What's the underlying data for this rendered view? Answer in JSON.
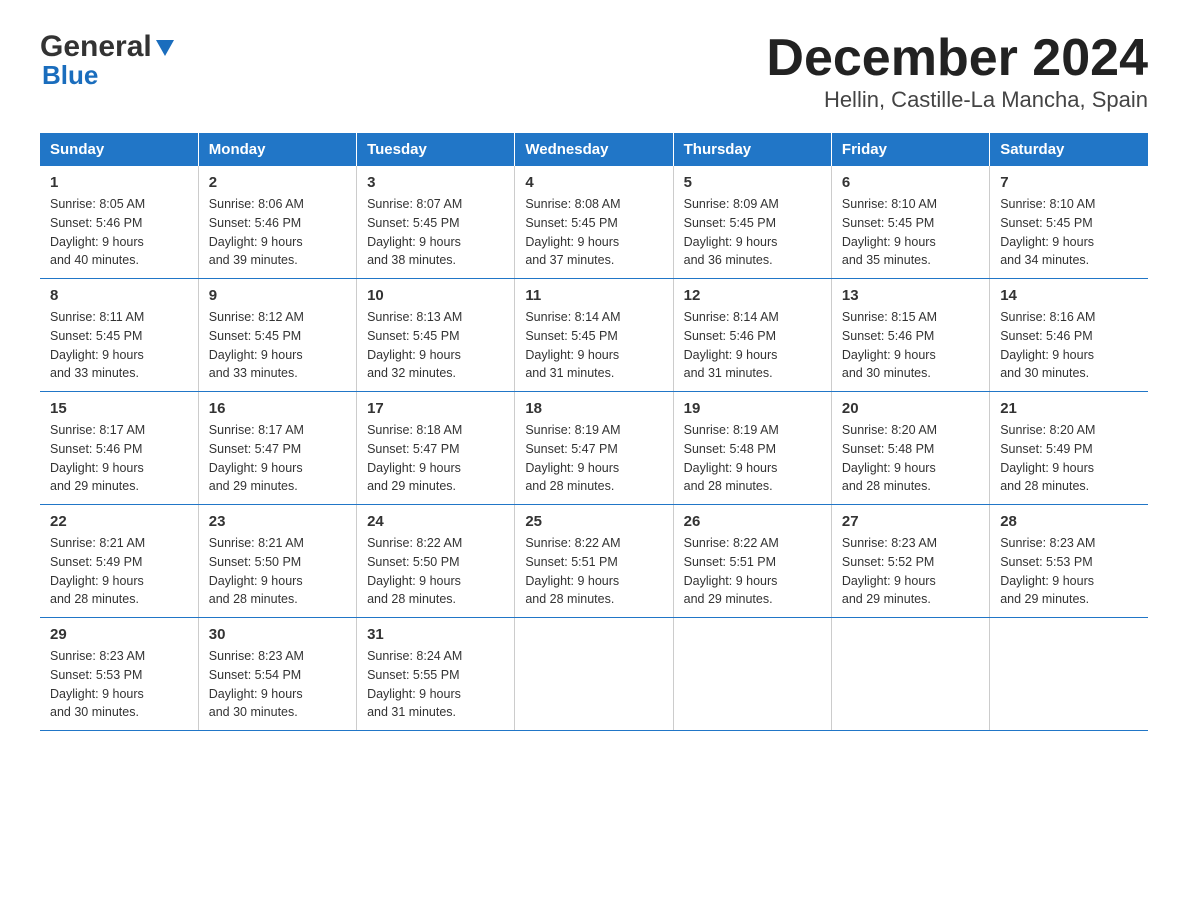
{
  "header": {
    "logo_general": "General",
    "logo_blue": "Blue",
    "title": "December 2024",
    "subtitle": "Hellin, Castille-La Mancha, Spain"
  },
  "days_of_week": [
    "Sunday",
    "Monday",
    "Tuesday",
    "Wednesday",
    "Thursday",
    "Friday",
    "Saturday"
  ],
  "weeks": [
    [
      {
        "day": "1",
        "sunrise": "8:05 AM",
        "sunset": "5:46 PM",
        "daylight": "9 hours and 40 minutes."
      },
      {
        "day": "2",
        "sunrise": "8:06 AM",
        "sunset": "5:46 PM",
        "daylight": "9 hours and 39 minutes."
      },
      {
        "day": "3",
        "sunrise": "8:07 AM",
        "sunset": "5:45 PM",
        "daylight": "9 hours and 38 minutes."
      },
      {
        "day": "4",
        "sunrise": "8:08 AM",
        "sunset": "5:45 PM",
        "daylight": "9 hours and 37 minutes."
      },
      {
        "day": "5",
        "sunrise": "8:09 AM",
        "sunset": "5:45 PM",
        "daylight": "9 hours and 36 minutes."
      },
      {
        "day": "6",
        "sunrise": "8:10 AM",
        "sunset": "5:45 PM",
        "daylight": "9 hours and 35 minutes."
      },
      {
        "day": "7",
        "sunrise": "8:10 AM",
        "sunset": "5:45 PM",
        "daylight": "9 hours and 34 minutes."
      }
    ],
    [
      {
        "day": "8",
        "sunrise": "8:11 AM",
        "sunset": "5:45 PM",
        "daylight": "9 hours and 33 minutes."
      },
      {
        "day": "9",
        "sunrise": "8:12 AM",
        "sunset": "5:45 PM",
        "daylight": "9 hours and 33 minutes."
      },
      {
        "day": "10",
        "sunrise": "8:13 AM",
        "sunset": "5:45 PM",
        "daylight": "9 hours and 32 minutes."
      },
      {
        "day": "11",
        "sunrise": "8:14 AM",
        "sunset": "5:45 PM",
        "daylight": "9 hours and 31 minutes."
      },
      {
        "day": "12",
        "sunrise": "8:14 AM",
        "sunset": "5:46 PM",
        "daylight": "9 hours and 31 minutes."
      },
      {
        "day": "13",
        "sunrise": "8:15 AM",
        "sunset": "5:46 PM",
        "daylight": "9 hours and 30 minutes."
      },
      {
        "day": "14",
        "sunrise": "8:16 AM",
        "sunset": "5:46 PM",
        "daylight": "9 hours and 30 minutes."
      }
    ],
    [
      {
        "day": "15",
        "sunrise": "8:17 AM",
        "sunset": "5:46 PM",
        "daylight": "9 hours and 29 minutes."
      },
      {
        "day": "16",
        "sunrise": "8:17 AM",
        "sunset": "5:47 PM",
        "daylight": "9 hours and 29 minutes."
      },
      {
        "day": "17",
        "sunrise": "8:18 AM",
        "sunset": "5:47 PM",
        "daylight": "9 hours and 29 minutes."
      },
      {
        "day": "18",
        "sunrise": "8:19 AM",
        "sunset": "5:47 PM",
        "daylight": "9 hours and 28 minutes."
      },
      {
        "day": "19",
        "sunrise": "8:19 AM",
        "sunset": "5:48 PM",
        "daylight": "9 hours and 28 minutes."
      },
      {
        "day": "20",
        "sunrise": "8:20 AM",
        "sunset": "5:48 PM",
        "daylight": "9 hours and 28 minutes."
      },
      {
        "day": "21",
        "sunrise": "8:20 AM",
        "sunset": "5:49 PM",
        "daylight": "9 hours and 28 minutes."
      }
    ],
    [
      {
        "day": "22",
        "sunrise": "8:21 AM",
        "sunset": "5:49 PM",
        "daylight": "9 hours and 28 minutes."
      },
      {
        "day": "23",
        "sunrise": "8:21 AM",
        "sunset": "5:50 PM",
        "daylight": "9 hours and 28 minutes."
      },
      {
        "day": "24",
        "sunrise": "8:22 AM",
        "sunset": "5:50 PM",
        "daylight": "9 hours and 28 minutes."
      },
      {
        "day": "25",
        "sunrise": "8:22 AM",
        "sunset": "5:51 PM",
        "daylight": "9 hours and 28 minutes."
      },
      {
        "day": "26",
        "sunrise": "8:22 AM",
        "sunset": "5:51 PM",
        "daylight": "9 hours and 29 minutes."
      },
      {
        "day": "27",
        "sunrise": "8:23 AM",
        "sunset": "5:52 PM",
        "daylight": "9 hours and 29 minutes."
      },
      {
        "day": "28",
        "sunrise": "8:23 AM",
        "sunset": "5:53 PM",
        "daylight": "9 hours and 29 minutes."
      }
    ],
    [
      {
        "day": "29",
        "sunrise": "8:23 AM",
        "sunset": "5:53 PM",
        "daylight": "9 hours and 30 minutes."
      },
      {
        "day": "30",
        "sunrise": "8:23 AM",
        "sunset": "5:54 PM",
        "daylight": "9 hours and 30 minutes."
      },
      {
        "day": "31",
        "sunrise": "8:24 AM",
        "sunset": "5:55 PM",
        "daylight": "9 hours and 31 minutes."
      },
      null,
      null,
      null,
      null
    ]
  ],
  "labels": {
    "sunrise": "Sunrise:",
    "sunset": "Sunset:",
    "daylight": "Daylight:"
  }
}
